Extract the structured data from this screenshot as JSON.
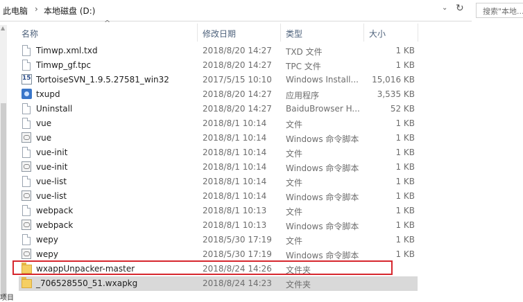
{
  "address": {
    "crumbs": [
      "此电脑",
      "本地磁盘 (D:)"
    ],
    "separator": "›",
    "dropdown_glyph": "⌄",
    "refresh_glyph": "↻",
    "search_placeholder": "搜索\"本地..."
  },
  "header": {
    "name": "名称",
    "date": "修改日期",
    "type": "类型",
    "size": "大小",
    "sort_glyph": "^"
  },
  "corner_text": "项目",
  "files": [
    {
      "name": "Timwp.xml.txd",
      "date": "2018/8/20 14:27",
      "type": "TXD 文件",
      "size": "1 KB",
      "icon": "file-icon"
    },
    {
      "name": "Timwp_gf.tpc",
      "date": "2018/8/20 14:27",
      "type": "TPC 文件",
      "size": "1 KB",
      "icon": "file-icon"
    },
    {
      "name": "TortoiseSVN_1.9.5.27581_win32",
      "date": "2017/5/15 10:10",
      "type": "Windows Install...",
      "size": "15,016 KB",
      "icon": "installer-icon"
    },
    {
      "name": "txupd",
      "date": "2018/8/20 14:27",
      "type": "应用程序",
      "size": "3,535 KB",
      "icon": "app-icon"
    },
    {
      "name": "Uninstall",
      "date": "2018/8/20 14:27",
      "type": "BaiduBrowser H...",
      "size": "52 KB",
      "icon": "file-icon"
    },
    {
      "name": "vue",
      "date": "2018/8/1 10:14",
      "type": "文件",
      "size": "1 KB",
      "icon": "file-icon"
    },
    {
      "name": "vue",
      "date": "2018/8/1 10:14",
      "type": "Windows 命令脚本",
      "size": "1 KB",
      "icon": "script-icon"
    },
    {
      "name": "vue-init",
      "date": "2018/8/1 10:14",
      "type": "文件",
      "size": "1 KB",
      "icon": "file-icon"
    },
    {
      "name": "vue-init",
      "date": "2018/8/1 10:14",
      "type": "Windows 命令脚本",
      "size": "1 KB",
      "icon": "script-icon"
    },
    {
      "name": "vue-list",
      "date": "2018/8/1 10:14",
      "type": "文件",
      "size": "1 KB",
      "icon": "file-icon"
    },
    {
      "name": "vue-list",
      "date": "2018/8/1 10:14",
      "type": "Windows 命令脚本",
      "size": "1 KB",
      "icon": "script-icon"
    },
    {
      "name": "webpack",
      "date": "2018/8/1 10:13",
      "type": "文件",
      "size": "1 KB",
      "icon": "file-icon"
    },
    {
      "name": "webpack",
      "date": "2018/8/1 10:13",
      "type": "Windows 命令脚本",
      "size": "1 KB",
      "icon": "script-icon"
    },
    {
      "name": "wepy",
      "date": "2018/5/30 17:19",
      "type": "文件",
      "size": "1 KB",
      "icon": "file-icon"
    },
    {
      "name": "wepy",
      "date": "2018/5/30 17:19",
      "type": "Windows 命令脚本",
      "size": "1 KB",
      "icon": "script-icon"
    },
    {
      "name": "wxappUnpacker-master",
      "date": "2018/8/24 14:26",
      "type": "文件夹",
      "size": "",
      "icon": "folder-icon"
    },
    {
      "name": "_706528550_51.wxapkg",
      "date": "2018/8/24 14:23",
      "type": "文件夹",
      "size": "",
      "icon": "folder-icon"
    }
  ],
  "highlight_color": "#d6262d",
  "selected_row_color": "#d9d9d9"
}
